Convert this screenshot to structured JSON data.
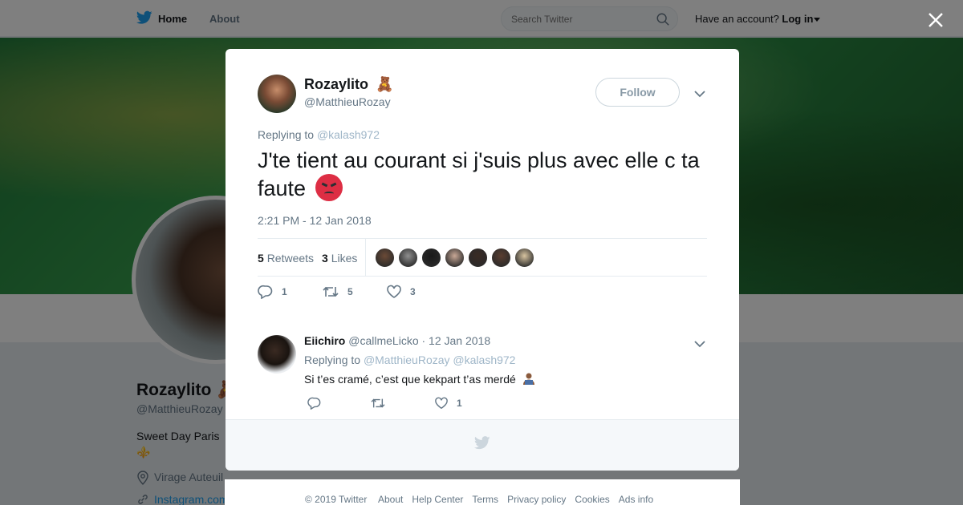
{
  "topbar": {
    "home_label": "Home",
    "about_label": "About",
    "search_placeholder": "Search Twitter",
    "have_account": "Have an account?",
    "login_label": "Log in",
    "brand_color": "#1da1f2"
  },
  "profile": {
    "name": "Rozaylito",
    "handle": "@MatthieuRozay",
    "bio_line1": "Sweet Day Paris",
    "bio_line2": "⚜️",
    "location": "Virage Auteuil",
    "url": "Instagram.com"
  },
  "tweet": {
    "author_name": "Rozaylito",
    "author_emoji": "🧸",
    "author_handle": "@MatthieuRozay",
    "follow_label": "Follow",
    "replying_label": "Replying to",
    "replying_to": "@kalash972",
    "text": "J'te tient au courant si j'suis plus avec elle c ta faute",
    "timestamp": "2:21 PM - 12 Jan 2018",
    "retweet_count": "5",
    "retweet_label": "Retweets",
    "like_count": "3",
    "like_label": "Likes",
    "likers": [
      "#6b4a36",
      "#8f8f8f",
      "#1a1a1a",
      "#c9a896",
      "#3a2b24",
      "#5a3d30",
      "#d8c4a0"
    ],
    "reply_action_count": "1",
    "retweet_action_count": "5",
    "like_action_count": "3"
  },
  "reply": {
    "name": "Eiichiro",
    "handle": "@callmeLicko",
    "date": "· 12 Jan 2018",
    "replying_label": "Replying to",
    "replying_to_1": "@MatthieuRozay",
    "replying_to_2": "@kalash972",
    "text": "Si t’es cramé, c’est que kekpart t’as merdé",
    "like_count": "1"
  },
  "footer": {
    "copyright": "© 2019 Twitter",
    "links": [
      "About",
      "Help Center",
      "Terms",
      "Privacy policy",
      "Cookies",
      "Ads info"
    ]
  }
}
